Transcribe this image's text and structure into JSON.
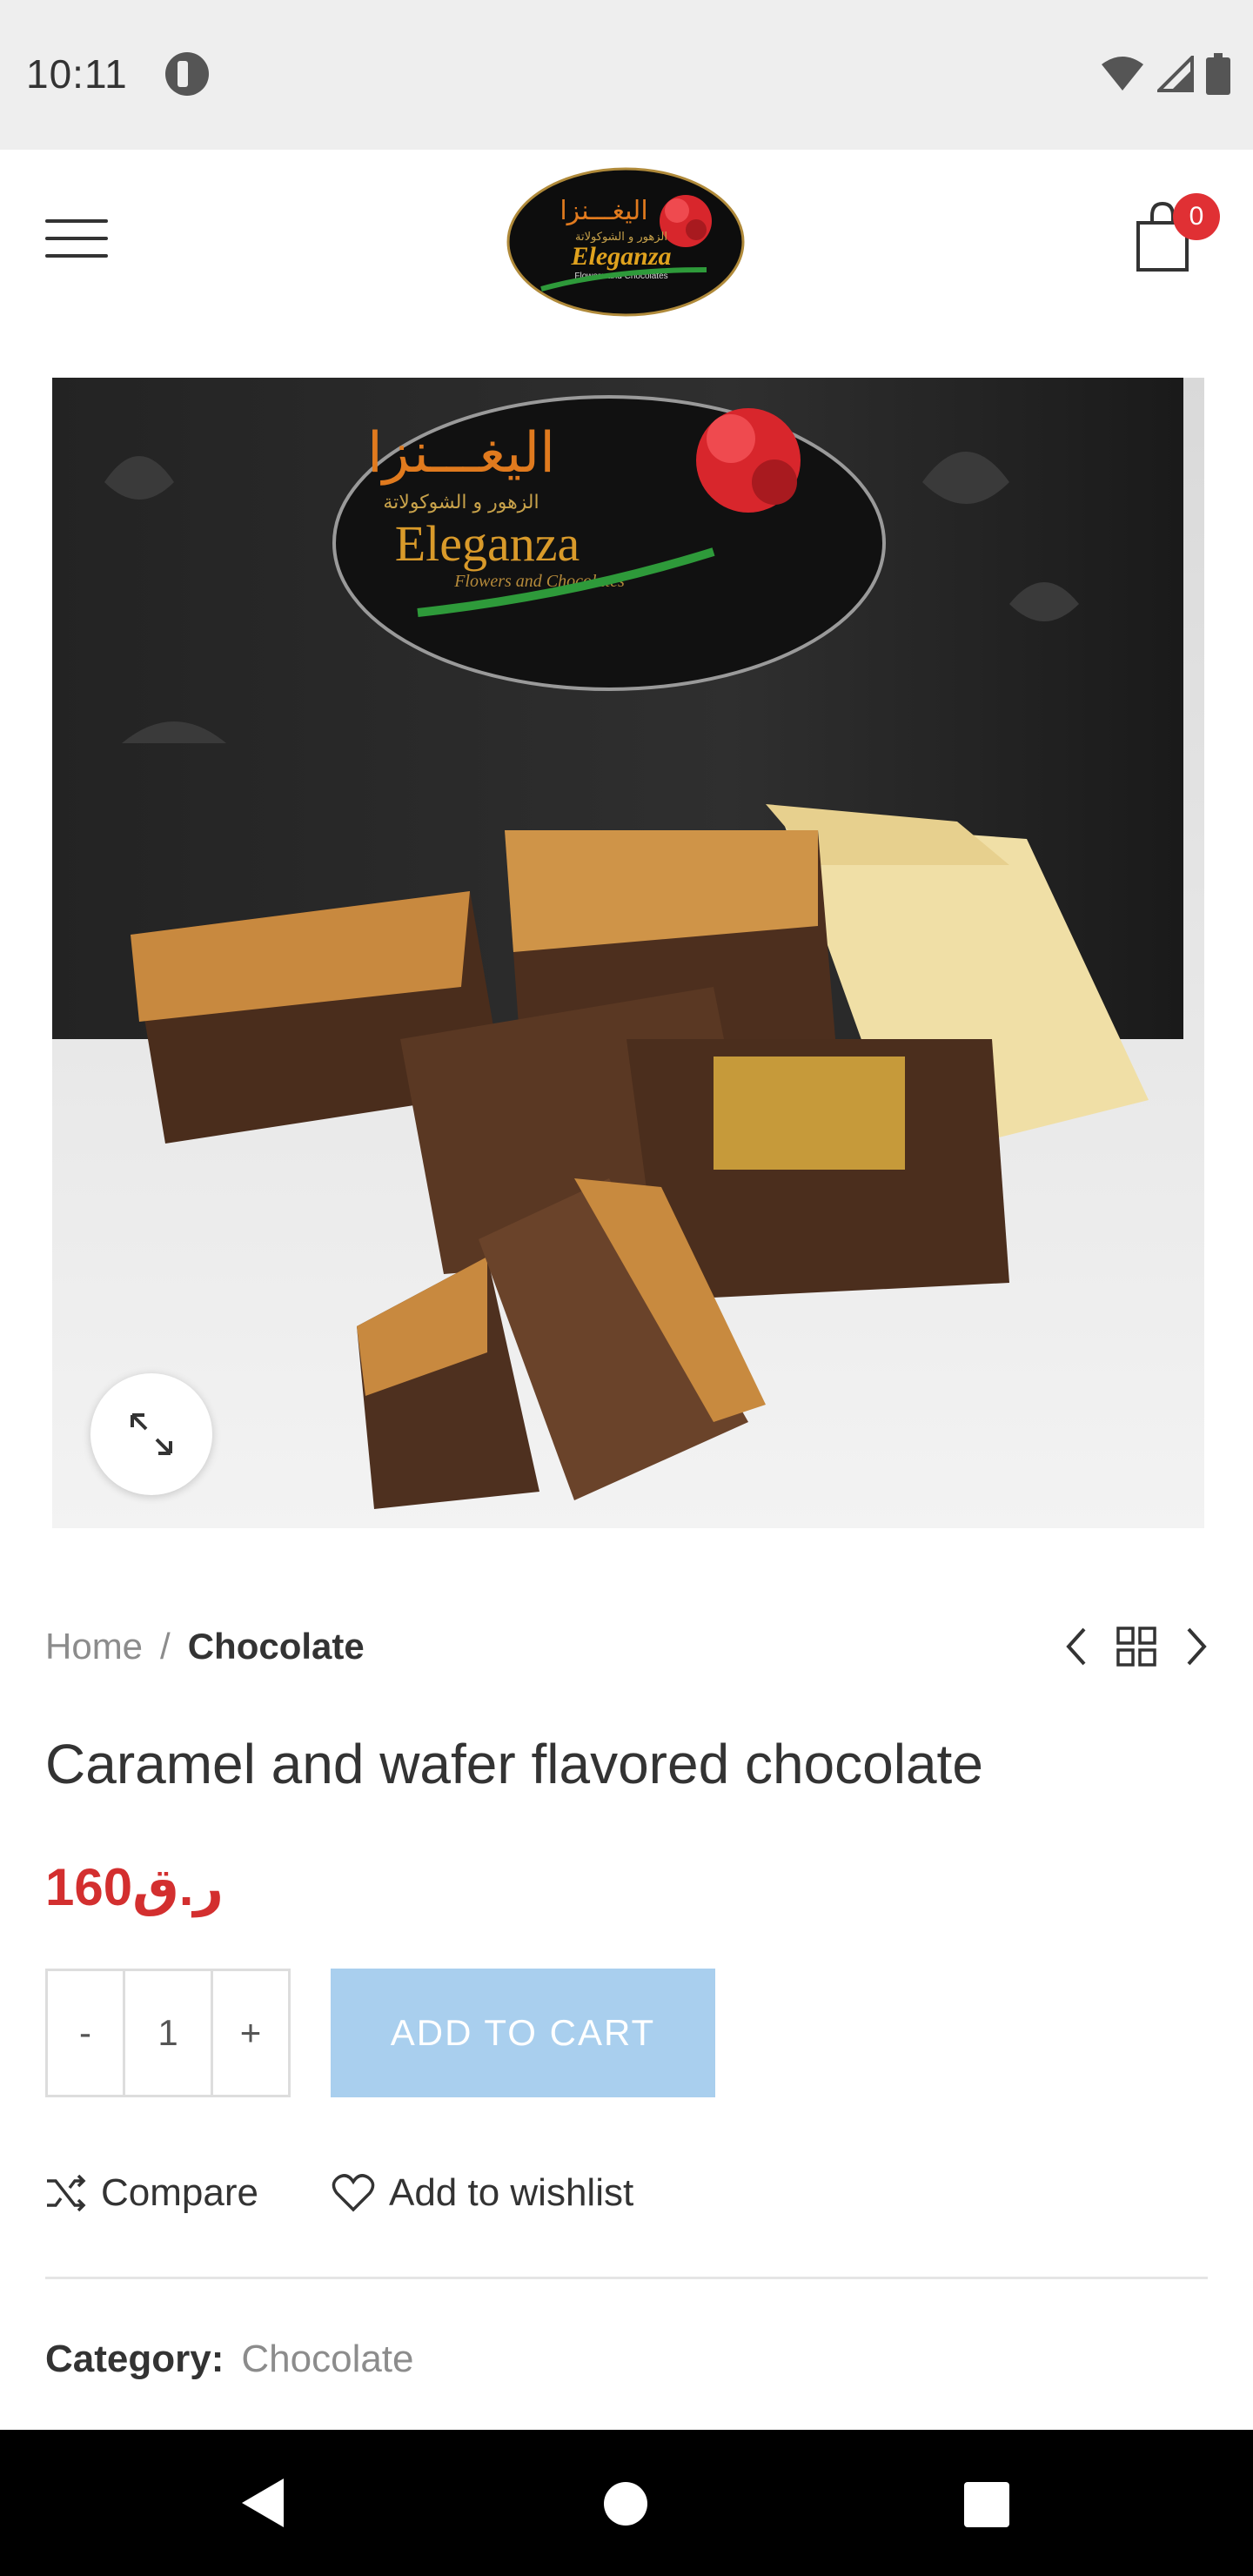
{
  "status_bar": {
    "time": "10:11"
  },
  "header": {
    "logo": {
      "arabic": "اليغـــنزا",
      "arabic_sub": "الزهور و الشوكولاتة",
      "name": "Eleganza",
      "tagline": "Flowers and Chocolates"
    },
    "cart_count": "0"
  },
  "image_logo": {
    "arabic": "اليغـــنزا",
    "arabic_sub": "الزهور و الشوكولاتة",
    "name": "Eleganza",
    "tagline": "Flowers and Chocolates"
  },
  "breadcrumb": {
    "home": "Home",
    "separator": "/",
    "current": "Chocolate"
  },
  "product": {
    "title": "Caramel and wafer flavored chocolate",
    "price": "ر.ق160",
    "quantity": "1",
    "minus": "-",
    "plus": "+",
    "add_to_cart": "ADD TO CART",
    "compare": "Compare",
    "wishlist": "Add to wishlist",
    "category_label": "Category:",
    "category_value": "Chocolate"
  },
  "colors": {
    "price": "#d32f2f",
    "badge": "#e03034",
    "add_to_cart_bg": "#a9cfee"
  }
}
